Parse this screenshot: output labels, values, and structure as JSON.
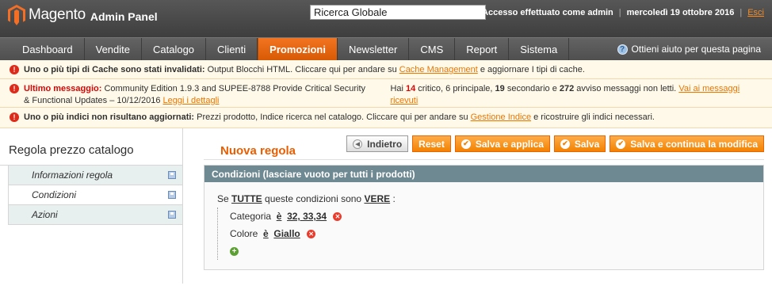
{
  "header": {
    "brand": "Magento",
    "panel": "Admin Panel",
    "search_value": "Ricerca Globale",
    "login_text": "Accesso effettuato come admin",
    "date": "mercoledì 19 ottobre 2016",
    "logout": "Esci"
  },
  "nav": {
    "items": [
      "Dashboard",
      "Vendite",
      "Catalogo",
      "Clienti",
      "Promozioni",
      "Newsletter",
      "CMS",
      "Report",
      "Sistema"
    ],
    "help": "Ottieni aiuto per questa pagina"
  },
  "messages": {
    "m1_bold": "Uno o più tipi di Cache sono stati invalidati:",
    "m1_text": " Output Blocchi HTML. Cliccare qui per andare su ",
    "m1_link": "Cache Management",
    "m1_tail": " e aggiornare I tipi di cache.",
    "m2_bold": "Ultimo messaggio:",
    "m2_text": " Community Edition 1.9.3 and SUPEE-8788 Provide Critical Security & Functional Updates – 10/12/2016 ",
    "m2_link": "Leggi i dettagli",
    "m2_hai": "Hai ",
    "m2_critico_n": "14",
    "m2_critico": " critico",
    "m2_principale": ", 6 principale, ",
    "m2_secondario_n": "19",
    "m2_secondario": " secondario e ",
    "m2_avviso_n": "272",
    "m2_avviso": " avviso messaggi non letti. ",
    "m2_link2": "Vai ai messaggi ricevuti",
    "m3_bold": "Uno o più indici non risultano aggiornati:",
    "m3_text": " Prezzi prodotto, Indice ricerca nel catalogo. Cliccare qui per andare su ",
    "m3_link": "Gestione Indice",
    "m3_tail": " e ricostruire gli indici necessari."
  },
  "sidebar": {
    "title": "Regola prezzo catalogo",
    "tabs": [
      "Informazioni regola",
      "Condizioni",
      "Azioni"
    ]
  },
  "main": {
    "title": "Nuova regola",
    "buttons": {
      "back": "Indietro",
      "reset": "Reset",
      "save_apply": "Salva e applica",
      "save": "Salva",
      "save_continue": "Salva e continua la modifica"
    },
    "section_title": "Condizioni (lasciare vuoto per tutti i prodotti)",
    "rule": {
      "se": "Se ",
      "all": "TUTTE",
      "mid": "  queste condizioni sono ",
      "true": "VERE",
      "end": " :"
    },
    "conditions": [
      {
        "attr": "Categoria",
        "op": "è",
        "value": "32, 33,34"
      },
      {
        "attr": "Colore",
        "op": "è",
        "value": "Giallo"
      }
    ]
  },
  "colors": {
    "accent": "#eb5e00",
    "nav_active": "#f37421",
    "section_head": "#6f8992"
  }
}
